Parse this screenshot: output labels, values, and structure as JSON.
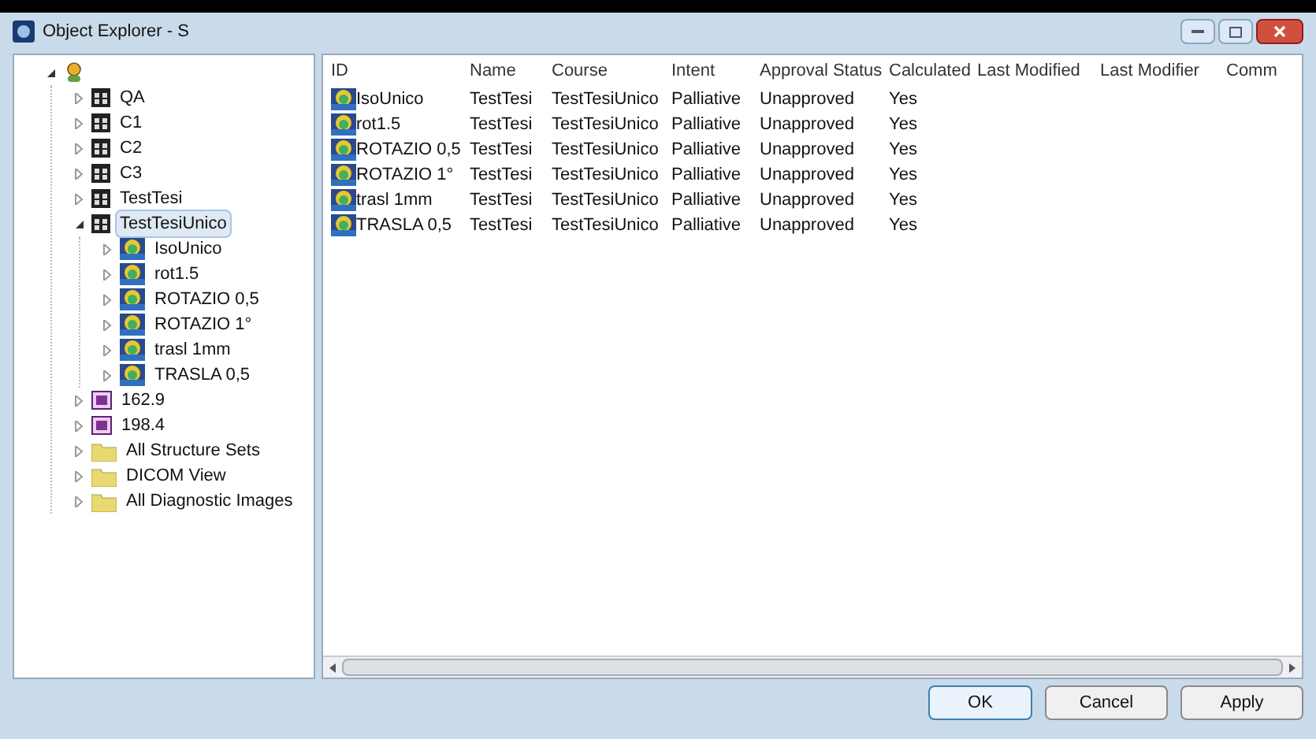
{
  "window": {
    "title": "Object Explorer - S"
  },
  "tree": [
    {
      "kind": "patient",
      "expanded": true,
      "selected": false,
      "children": [
        {
          "label": "QA",
          "kind": "course",
          "expanded": false,
          "selected": false
        },
        {
          "label": "C1",
          "kind": "course",
          "expanded": false,
          "selected": false
        },
        {
          "label": "C2",
          "kind": "course",
          "expanded": false,
          "selected": false
        },
        {
          "label": "C3",
          "kind": "course",
          "expanded": false,
          "selected": false
        },
        {
          "label": "TestTesi",
          "kind": "course",
          "expanded": false,
          "selected": false
        },
        {
          "label": "TestTesiUnico",
          "kind": "course",
          "expanded": true,
          "selected": true,
          "children": [
            {
              "label": "IsoUnico",
              "kind": "plan",
              "expanded": false,
              "selected": false
            },
            {
              "label": "rot1.5",
              "kind": "plan",
              "expanded": false,
              "selected": false
            },
            {
              "label": "ROTAZIO 0,5",
              "kind": "plan",
              "expanded": false,
              "selected": false
            },
            {
              "label": "ROTAZIO 1°",
              "kind": "plan",
              "expanded": false,
              "selected": false
            },
            {
              "label": "trasl 1mm",
              "kind": "plan",
              "expanded": false,
              "selected": false
            },
            {
              "label": "TRASLA 0,5",
              "kind": "plan",
              "expanded": false,
              "selected": false
            }
          ]
        },
        {
          "label": "162.9",
          "kind": "image",
          "expanded": false,
          "selected": false
        },
        {
          "label": "198.4",
          "kind": "image",
          "expanded": false,
          "selected": false
        },
        {
          "label": "All Structure Sets",
          "kind": "folder",
          "expanded": false,
          "selected": false
        },
        {
          "label": "DICOM View",
          "kind": "folder",
          "expanded": false,
          "selected": false
        },
        {
          "label": "All Diagnostic Images",
          "kind": "folder",
          "expanded": false,
          "selected": false
        }
      ]
    }
  ],
  "table": {
    "columns": [
      "ID",
      "Name",
      "Course",
      "Intent",
      "Approval Status",
      "Calculated",
      "Last Modified",
      "Last Modifier",
      "Comm"
    ],
    "rows": [
      [
        "IsoUnico",
        "TestTesi",
        "TestTesiUnico",
        "Palliative",
        "Unapproved",
        "Yes"
      ],
      [
        "rot1.5",
        "TestTesi",
        "TestTesiUnico",
        "Palliative",
        "Unapproved",
        "Yes"
      ],
      [
        "ROTAZIO 0,5",
        "TestTesi",
        "TestTesiUnico",
        "Palliative",
        "Unapproved",
        "Yes"
      ],
      [
        "ROTAZIO 1°",
        "TestTesi",
        "TestTesiUnico",
        "Palliative",
        "Unapproved",
        "Yes"
      ],
      [
        "trasl 1mm",
        "TestTesi",
        "TestTesiUnico",
        "Palliative",
        "Unapproved",
        "Yes"
      ],
      [
        "TRASLA 0,5",
        "TestTesi",
        "TestTesiUnico",
        "Palliative",
        "Unapproved",
        "Yes"
      ]
    ]
  },
  "buttons": [
    "OK",
    "Cancel",
    "Apply"
  ]
}
